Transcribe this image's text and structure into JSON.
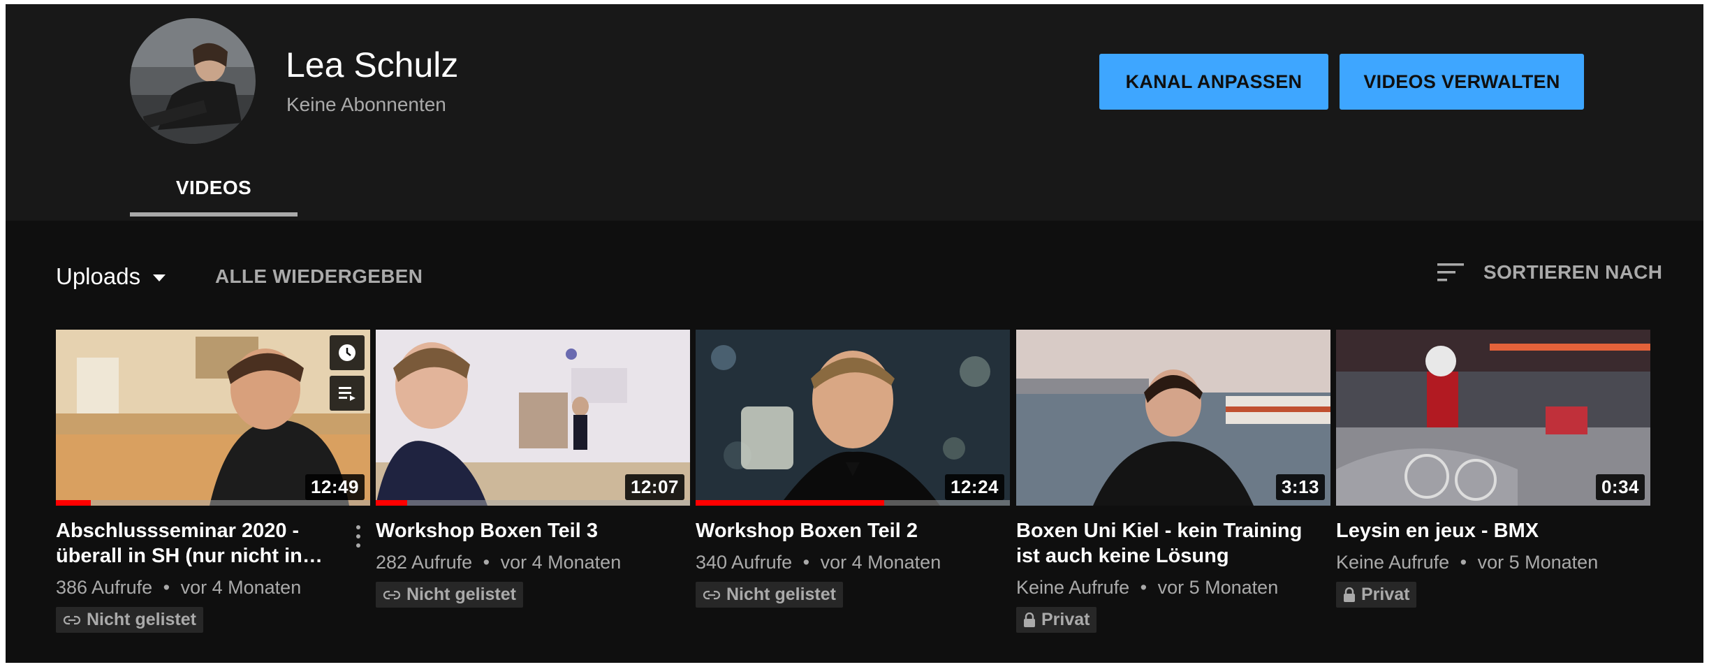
{
  "channel": {
    "name": "Lea Schulz",
    "subscribers": "Keine Abonnenten"
  },
  "buttons": {
    "customize": "KANAL ANPASSEN",
    "manage": "VIDEOS VERWALTEN"
  },
  "tabs": [
    {
      "label": "VIDEOS",
      "active": true
    }
  ],
  "toolbar": {
    "uploads": "Uploads",
    "play_all": "ALLE WIEDERGEBEN",
    "sort": "SORTIEREN NACH"
  },
  "colors": {
    "accent": "#3ea6ff",
    "progress": "#ff0000",
    "background": "#0f0f0f"
  },
  "videos": [
    {
      "title": "Abschlussseminar 2020 - überall in SH (nur nicht in…",
      "duration": "12:49",
      "views": "386 Aufrufe",
      "age": "vor 4 Monaten",
      "visibility": "Nicht gelistet",
      "visibility_icon": "link-icon",
      "watched_fraction": 0.11
    },
    {
      "title": "Workshop Boxen Teil 3",
      "duration": "12:07",
      "views": "282 Aufrufe",
      "age": "vor 4 Monaten",
      "visibility": "Nicht gelistet",
      "visibility_icon": "link-icon",
      "watched_fraction": 0.1
    },
    {
      "title": "Workshop Boxen Teil 2",
      "duration": "12:24",
      "views": "340 Aufrufe",
      "age": "vor 4 Monaten",
      "visibility": "Nicht gelistet",
      "visibility_icon": "link-icon",
      "watched_fraction": 0.6
    },
    {
      "title": "Boxen Uni Kiel - kein Training ist auch keine Lösung",
      "duration": "3:13",
      "views": "Keine Aufrufe",
      "age": "vor 5 Monaten",
      "visibility": "Privat",
      "visibility_icon": "lock-icon",
      "watched_fraction": 0
    },
    {
      "title": "Leysin en jeux - BMX",
      "duration": "0:34",
      "views": "Keine Aufrufe",
      "age": "vor 5 Monaten",
      "visibility": "Privat",
      "visibility_icon": "lock-icon",
      "watched_fraction": 0
    }
  ],
  "separator": "•"
}
